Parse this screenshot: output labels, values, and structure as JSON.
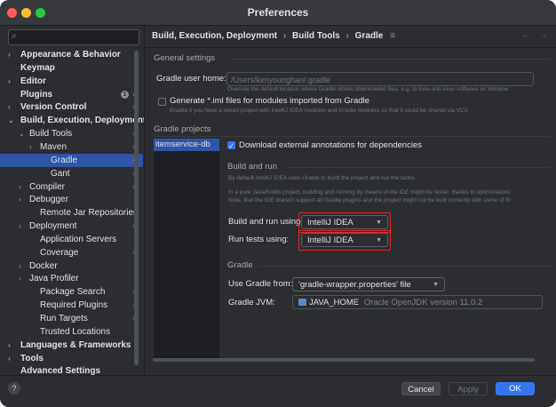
{
  "window": {
    "title": "Preferences",
    "traffic_lights": [
      "#ff5f57",
      "#febc2e",
      "#28c840"
    ]
  },
  "sidebar": {
    "search_placeholder": "",
    "items": [
      {
        "label": "Appearance & Behavior",
        "bold": true,
        "indent": 0,
        "chevron": "›"
      },
      {
        "label": "Keymap",
        "bold": true,
        "indent": 0,
        "chevron": ""
      },
      {
        "label": "Editor",
        "bold": true,
        "indent": 0,
        "chevron": "›"
      },
      {
        "label": "Plugins",
        "bold": true,
        "indent": 0,
        "chevron": "",
        "badge": "1",
        "cog": true
      },
      {
        "label": "Version Control",
        "bold": true,
        "indent": 0,
        "chevron": "›",
        "cog": true
      },
      {
        "label": "Build, Execution, Deployment",
        "bold": true,
        "indent": 0,
        "chevron": "⌄"
      },
      {
        "label": "Build Tools",
        "bold": false,
        "indent": 1,
        "chevron": "⌄",
        "cog": true
      },
      {
        "label": "Maven",
        "bold": false,
        "indent": 2,
        "chevron": "›",
        "cog": true
      },
      {
        "label": "Gradle",
        "bold": false,
        "indent": 3,
        "chevron": "",
        "cog": true,
        "selected": true
      },
      {
        "label": "Gant",
        "bold": false,
        "indent": 3,
        "chevron": "",
        "cog": true
      },
      {
        "label": "Compiler",
        "bold": false,
        "indent": 1,
        "chevron": "›",
        "cog": true
      },
      {
        "label": "Debugger",
        "bold": false,
        "indent": 1,
        "chevron": "›"
      },
      {
        "label": "Remote Jar Repositories",
        "bold": false,
        "indent": 2,
        "chevron": "",
        "cog": true
      },
      {
        "label": "Deployment",
        "bold": false,
        "indent": 1,
        "chevron": "›",
        "cog": true
      },
      {
        "label": "Application Servers",
        "bold": false,
        "indent": 2,
        "chevron": ""
      },
      {
        "label": "Coverage",
        "bold": false,
        "indent": 2,
        "chevron": "",
        "cog": true
      },
      {
        "label": "Docker",
        "bold": false,
        "indent": 1,
        "chevron": "›"
      },
      {
        "label": "Java Profiler",
        "bold": false,
        "indent": 1,
        "chevron": "›"
      },
      {
        "label": "Package Search",
        "bold": false,
        "indent": 2,
        "chevron": "",
        "cog": true
      },
      {
        "label": "Required Plugins",
        "bold": false,
        "indent": 2,
        "chevron": "",
        "cog": true
      },
      {
        "label": "Run Targets",
        "bold": false,
        "indent": 2,
        "chevron": "",
        "cog": true
      },
      {
        "label": "Trusted Locations",
        "bold": false,
        "indent": 2,
        "chevron": ""
      },
      {
        "label": "Languages & Frameworks",
        "bold": true,
        "indent": 0,
        "chevron": "›"
      },
      {
        "label": "Tools",
        "bold": true,
        "indent": 0,
        "chevron": "›"
      },
      {
        "label": "Advanced Settings",
        "bold": true,
        "indent": 0,
        "chevron": ""
      }
    ]
  },
  "breadcrumb": {
    "parts": [
      "Build, Execution, Deployment",
      "Build Tools",
      "Gradle"
    ],
    "separator": "›",
    "settings_icon": "≡",
    "back": "←",
    "forward": "→"
  },
  "general": {
    "section_label": "General settings",
    "user_home_label": "Gradle user home:",
    "user_home_value": "/Users/kimyounghan/.gradle",
    "user_home_hint": "Override the default location where Gradle stores downloaded files, e.g. to tune anti-virus software on Window",
    "iml_label": "Generate *.iml files for modules imported from Gradle",
    "iml_hint": "Enable if you have a mixed project with IntelliJ IDEA modules and Gradle modules so that it could be shared via VCS"
  },
  "projects": {
    "section_label": "Gradle projects",
    "items": [
      "itemservice-db"
    ],
    "download_annotations_label": "Download external annotations for dependencies",
    "download_annotations_checked": true
  },
  "build_run": {
    "section_label": "Build and run",
    "hint1": "By default IntelliJ IDEA uses Gradle to build the project and run the tasks.",
    "hint2": "In a pure Java/Kotlin project, building and running by means of the IDE might be faster, thanks to optimizations",
    "hint3": "Note, that the IDE doesn't support all Gradle plugins and the project might not be built correctly with some of th",
    "build_using_label": "Build and run using:",
    "build_using_value": "IntelliJ IDEA",
    "tests_using_label": "Run tests using:",
    "tests_using_value": "IntelliJ IDEA",
    "highlight_color": "#e0282d"
  },
  "gradle": {
    "section_label": "Gradle",
    "use_from_label": "Use Gradle from:",
    "use_from_value": "'gradle-wrapper.properties' file",
    "jvm_label": "Gradle JVM:",
    "jvm_value_main": "JAVA_HOME",
    "jvm_value_detail": "Oracle OpenJDK version 11.0.2"
  },
  "buttons": {
    "help": "?",
    "cancel": "Cancel",
    "apply": "Apply",
    "ok": "OK",
    "ok_color": "#3574f0"
  }
}
